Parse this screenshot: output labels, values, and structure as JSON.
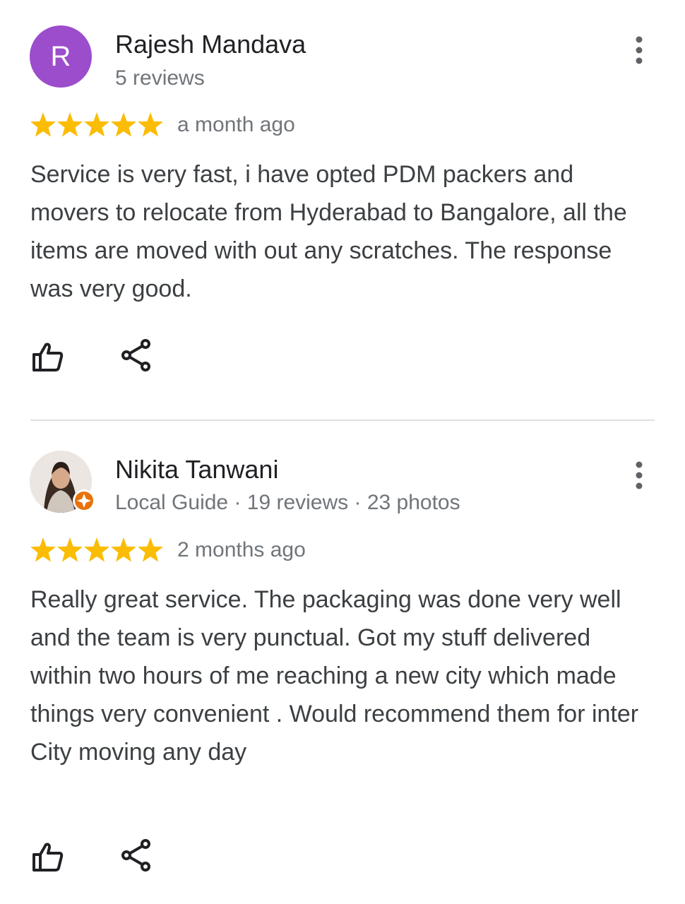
{
  "reviews": [
    {
      "author": "Rajesh Mandava",
      "avatar_letter": "R",
      "meta": "5 reviews",
      "rating": 5,
      "time": "a month ago",
      "text": "Service is very fast, i have opted PDM packers and movers to relocate from Hyderabad to Bangalore, all the items are moved with out any scratches. The response was very good.",
      "avatar_color": "#9c4dcc"
    },
    {
      "author": "Nikita Tanwani",
      "meta": "Local Guide · 19 reviews · 23 photos",
      "rating": 5,
      "time": "2 months ago",
      "text": "Really great service. The packaging was done very well and the team is very punctual. Got my stuff delivered within two hours of me reaching a new city which made things very convenient . Would recommend them for inter City moving any day",
      "badge_color": "#e8710a"
    }
  ],
  "icons": {
    "star": "star-icon",
    "like": "thumb-up-icon",
    "share": "share-icon",
    "more": "more-vert-icon"
  },
  "colors": {
    "star": "#fbbc04",
    "text": "#3c4043",
    "secondary": "#70757a"
  }
}
